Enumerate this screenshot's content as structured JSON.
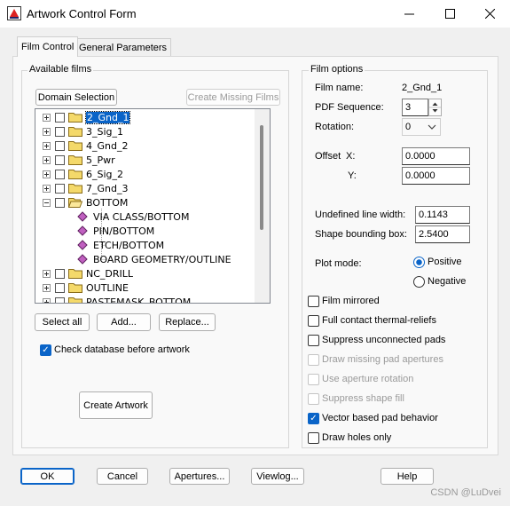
{
  "window": {
    "title": "Artwork Control Form",
    "minimize": "—",
    "maximize": "☐",
    "close": "✕"
  },
  "tabs": [
    {
      "label": "Film Control"
    },
    {
      "label": "General Parameters"
    }
  ],
  "available_films": {
    "group_label": "Available films",
    "domain_selection": "Domain Selection",
    "create_missing_films": "Create Missing Films",
    "tree": [
      {
        "label": "2_Gnd_1"
      },
      {
        "label": "3_Sig_1"
      },
      {
        "label": "4_Gnd_2"
      },
      {
        "label": "5_Pwr"
      },
      {
        "label": "6_Sig_2"
      },
      {
        "label": "7_Gnd_3"
      },
      {
        "label": "BOTTOM"
      },
      {
        "label": "VIA CLASS/BOTTOM"
      },
      {
        "label": "PIN/BOTTOM"
      },
      {
        "label": "ETCH/BOTTOM"
      },
      {
        "label": "BOARD GEOMETRY/OUTLINE"
      },
      {
        "label": "NC_DRILL"
      },
      {
        "label": "OUTLINE"
      },
      {
        "label": "PASTEMASK_BOTTOM"
      }
    ],
    "select_all": "Select all",
    "add": "Add...",
    "replace": "Replace...",
    "check_database_label": "Check database before artwork",
    "check_database_checked": true,
    "create_artwork": "Create Artwork"
  },
  "film_options": {
    "group_label": "Film options",
    "film_name_label": "Film name:",
    "film_name_value": "2_Gnd_1",
    "pdf_sequence_label": "PDF Sequence:",
    "pdf_sequence_value": "3",
    "rotation_label": "Rotation:",
    "rotation_value": "0",
    "offset_label": "Offset",
    "offset_x_label": "X:",
    "offset_x_value": "0.0000",
    "offset_y_label": "Y:",
    "offset_y_value": "0.0000",
    "undefined_line_width_label": "Undefined line width:",
    "undefined_line_width_value": "0.1143",
    "shape_bounding_box_label": "Shape bounding box:",
    "shape_bounding_box_value": "2.5400",
    "plot_mode_label": "Plot mode:",
    "positive_label": "Positive",
    "negative_label": "Negative",
    "plot_mode_selected": "Positive",
    "options": [
      {
        "label": "Film mirrored",
        "checked": false,
        "enabled": true
      },
      {
        "label": "Full contact thermal-reliefs",
        "checked": false,
        "enabled": true
      },
      {
        "label": "Suppress unconnected pads",
        "checked": false,
        "enabled": true
      },
      {
        "label": "Draw missing pad apertures",
        "checked": false,
        "enabled": false
      },
      {
        "label": "Use aperture rotation",
        "checked": false,
        "enabled": false
      },
      {
        "label": "Suppress shape fill",
        "checked": false,
        "enabled": false
      },
      {
        "label": "Vector based pad behavior",
        "checked": true,
        "enabled": true
      },
      {
        "label": "Draw holes only",
        "checked": false,
        "enabled": true
      }
    ]
  },
  "footer": {
    "ok": "OK",
    "cancel": "Cancel",
    "apertures": "Apertures...",
    "viewlog": "Viewlog...",
    "help": "Help"
  },
  "watermark": "CSDN @LuDvei",
  "colors": {
    "accent": "#0a64c8",
    "folder": "#f4d96a",
    "diamond": "#c060c0"
  }
}
